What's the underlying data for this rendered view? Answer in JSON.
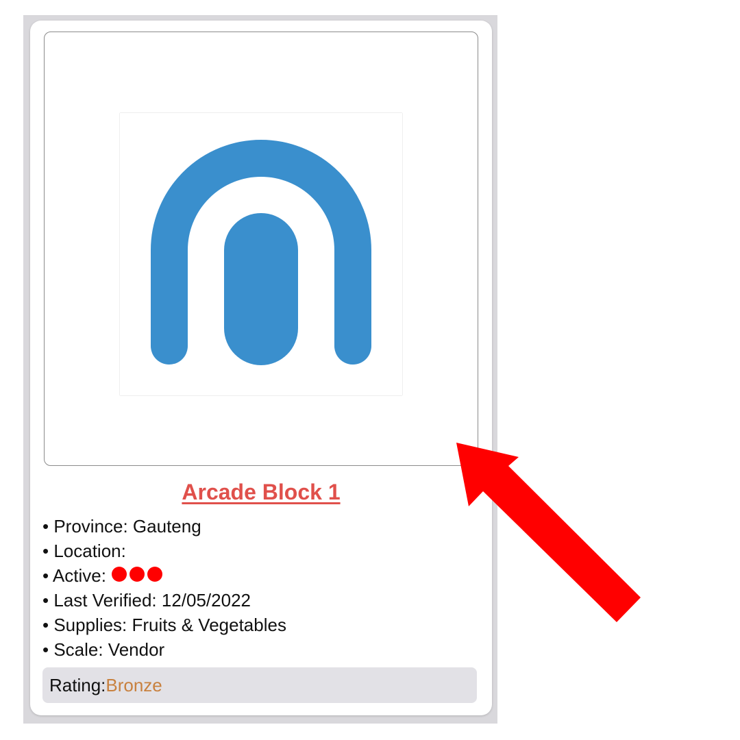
{
  "card": {
    "logo_icon": "arch-logo-icon",
    "logo_color": "#3a8fcd",
    "title": "Arcade Block 1",
    "title_color": "#e0504b",
    "details": {
      "province": "• Province: Gauteng",
      "location": "• Location:",
      "active": "• Active:",
      "active_dot_count": 3,
      "active_dot_color": "#ff0000",
      "last_verified": "• Last Verified: 12/05/2022",
      "supplies": "• Supplies: Fruits & Vegetables",
      "scale": "• Scale: Vendor"
    },
    "rating": {
      "label": "Rating:",
      "value": "Bronze",
      "value_color": "#c8813f"
    }
  },
  "annotation": {
    "icon": "red-arrow-icon",
    "color": "#ff0000"
  }
}
